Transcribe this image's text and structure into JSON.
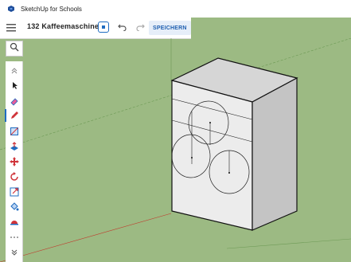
{
  "window": {
    "title": "SketchUp for Schools"
  },
  "toolbar": {
    "file_name": "132 Kaffeemaschine",
    "save_label": "SPEICHERN",
    "menu_icon": "hamburger-menu-icon",
    "info_icon": "model-info-icon",
    "undo_icon": "undo-icon",
    "redo_icon": "redo-icon"
  },
  "tools": [
    "search-icon",
    "collapse-up-icon",
    "select-icon",
    "eraser-icon",
    "pencil-icon",
    "rectangle-icon",
    "push-pull-icon",
    "move-icon",
    "rotate-icon",
    "scale-icon",
    "paint-bucket-icon",
    "tape-measure-icon",
    "more-tools-icon",
    "expand-down-icon"
  ],
  "colors": {
    "background": "#9cba83",
    "accent": "#1f6cc1",
    "face_top": "#d6d6d6",
    "face_front": "#ececec",
    "face_side": "#c4c4c4",
    "axis_red": "#c0392b"
  },
  "active_tool": "pencil-icon"
}
